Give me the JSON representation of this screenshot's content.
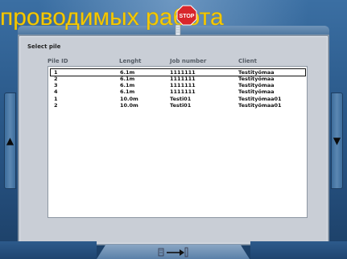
{
  "banner": {
    "text": "проводимых работа"
  },
  "stop_sign": {
    "label": "STOP"
  },
  "dialog": {
    "title": "Select pile",
    "columns": [
      "Pile ID",
      "Lenght",
      "Job number",
      "Client"
    ],
    "rows": [
      {
        "pile_id": "1",
        "length": "6.1m",
        "job_number": "1111111",
        "client": "Testityömaa",
        "selected": true
      },
      {
        "pile_id": "2",
        "length": "6.1m",
        "job_number": "1111111",
        "client": "Testityömaa"
      },
      {
        "pile_id": "3",
        "length": "6.1m",
        "job_number": "1111111",
        "client": "Testityömaa"
      },
      {
        "pile_id": "4",
        "length": "6.1m",
        "job_number": "1111111",
        "client": "Testityömaa"
      },
      {
        "pile_id": "1",
        "length": "10.0m",
        "job_number": "Testi01",
        "client": "Testityömaa01"
      },
      {
        "pile_id": "2",
        "length": "10.0m",
        "job_number": "Testi01",
        "client": "Testityömaa01"
      }
    ]
  },
  "controls": {
    "scroll_left_icon": "triangle-left-icon",
    "scroll_right_icon": "triangle-right-icon",
    "bottom_nav_icon": "pile-drive-arrow-icon"
  },
  "colors": {
    "frame": "#2b5a8b",
    "panel": "#c9ced6",
    "banner_text": "#f5c800",
    "stop_red": "#d8262c"
  }
}
